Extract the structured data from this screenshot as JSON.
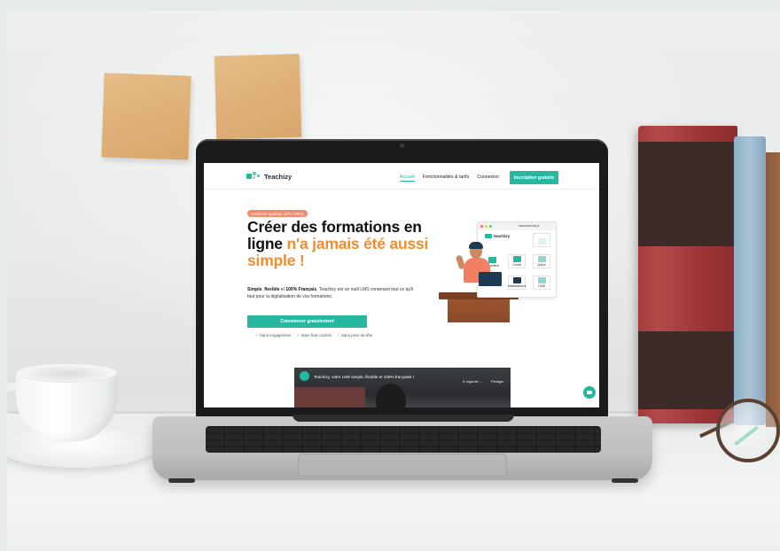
{
  "site": {
    "brand": "Teachizy",
    "nav": {
      "links": [
        "Accueil",
        "Fonctionnalités & tarifs",
        "Connexion"
      ],
      "active_index": 0,
      "cta": "Inscription gratuite"
    },
    "hero": {
      "badge": "Conforme Qualiopi, CPF, OPCO",
      "headline_part1": "Créer des formations en ligne ",
      "headline_highlight": "n'a jamais été aussi simple !",
      "description_bold1": "Simple",
      "description_sep1": ", ",
      "description_bold2": "flexible",
      "description_sep2": " et ",
      "description_bold3": "100% Français",
      "description_rest": ", Teachizy est un outil LMS contenant tout ce qu'il faut pour la digitalisation de vos formations.",
      "start_button": "Commencer gratuitement",
      "perks": [
        "Sans engagement",
        "Sans frais cachés",
        "Sans prise de tête"
      ]
    },
    "illustration": {
      "url": "www.teachizy.fr",
      "mini_brand": "teachizy",
      "tiles": [
        "Paiement",
        "Cours",
        "Quizz",
        "Webinaire",
        "Intelocuteurs",
        "CMS"
      ]
    },
    "video": {
      "title": "Teachizy, votre LMS simple, flexible et 100% française !",
      "later": "À regarder ...",
      "share": "Partager"
    }
  },
  "colors": {
    "accent": "#27b69e",
    "highlight": "#ef8d2f",
    "badge": "#f28b6d",
    "note": "#dfb07a",
    "book_red": "#a63b3c"
  }
}
